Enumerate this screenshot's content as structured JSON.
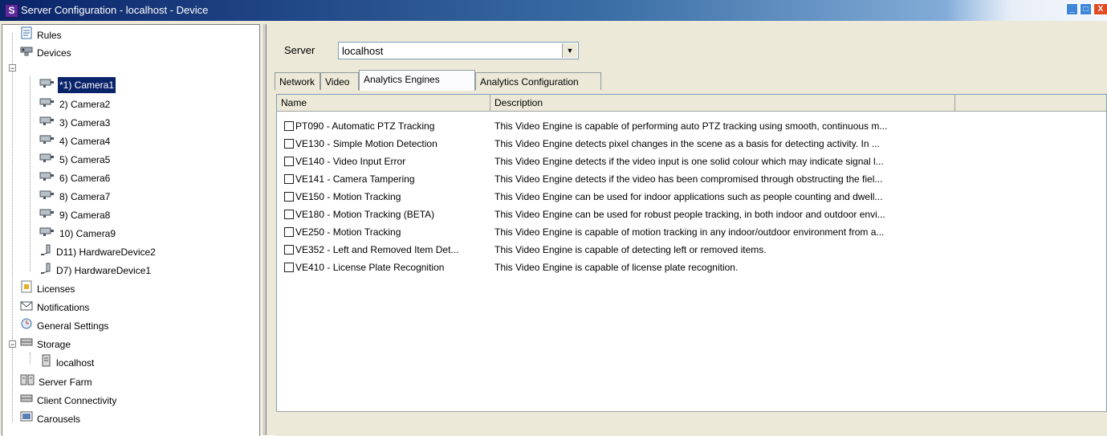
{
  "window": {
    "title": "Server Configuration - localhost - Device",
    "app_icon": "S",
    "controls": {
      "minimize": "_",
      "maximize": "□",
      "close": "X"
    }
  },
  "tree": {
    "items": [
      {
        "label": "Rules",
        "icon": "rules-icon"
      },
      {
        "label": "Devices",
        "icon": "devices-icon"
      },
      {
        "label": "*1) Camera1",
        "icon": "camera-icon"
      },
      {
        "label": "2) Camera2",
        "icon": "camera-icon"
      },
      {
        "label": "3) Camera3",
        "icon": "camera-icon"
      },
      {
        "label": "4) Camera4",
        "icon": "camera-icon"
      },
      {
        "label": "5) Camera5",
        "icon": "camera-icon"
      },
      {
        "label": "6) Camera6",
        "icon": "camera-icon"
      },
      {
        "label": "8) Camera7",
        "icon": "camera-icon"
      },
      {
        "label": "9) Camera8",
        "icon": "camera-icon"
      },
      {
        "label": "10) Camera9",
        "icon": "camera-icon"
      },
      {
        "label": "D11) HardwareDevice2",
        "icon": "hardware-device-icon"
      },
      {
        "label": "D7) HardwareDevice1",
        "icon": "hardware-device-icon"
      },
      {
        "label": "Licenses",
        "icon": "licenses-icon"
      },
      {
        "label": "Notifications",
        "icon": "notifications-icon"
      },
      {
        "label": "General Settings",
        "icon": "general-settings-icon"
      },
      {
        "label": "Storage",
        "icon": "storage-icon"
      },
      {
        "label": "localhost",
        "icon": "storage-server-icon"
      },
      {
        "label": "Server Farm",
        "icon": "server-farm-icon"
      },
      {
        "label": "Client Connectivity",
        "icon": "client-connectivity-icon"
      },
      {
        "label": "Carousels",
        "icon": "carousels-icon"
      }
    ],
    "selected": "*1) Camera1"
  },
  "server": {
    "label": "Server",
    "value": "localhost"
  },
  "tabs": [
    {
      "label": "Network"
    },
    {
      "label": "Video"
    },
    {
      "label": "Analytics Engines"
    },
    {
      "label": "Analytics Configuration"
    }
  ],
  "active_tab": "Analytics Engines",
  "table": {
    "columns": [
      "Name",
      "Description"
    ],
    "rows": [
      {
        "name": "PT090 - Automatic PTZ Tracking",
        "description": "This Video Engine is capable of performing auto PTZ tracking using smooth, continuous m..."
      },
      {
        "name": "VE130 - Simple Motion Detection",
        "description": "This Video Engine detects pixel changes in the scene as a basis for detecting activity. In ..."
      },
      {
        "name": "VE140 - Video Input Error",
        "description": "This Video Engine detects if the video input is one solid colour which may indicate signal l..."
      },
      {
        "name": "VE141 - Camera Tampering",
        "description": "This Video Engine detects if the video has been compromised through obstructing the fiel..."
      },
      {
        "name": "VE150 - Motion Tracking",
        "description": "This Video Engine can be used for indoor applications such as people counting and dwell..."
      },
      {
        "name": "VE180 - Motion Tracking (BETA)",
        "description": "This Video Engine can be used for robust people tracking, in both indoor and outdoor envi..."
      },
      {
        "name": "VE250 - Motion Tracking",
        "description": "This Video Engine is capable of motion tracking in any indoor/outdoor environment from a..."
      },
      {
        "name": "VE352 - Left and Removed Item Det...",
        "description": "This Video Engine is capable of detecting left or removed items."
      },
      {
        "name": "VE410 - License Plate Recognition",
        "description": "This Video Engine is capable of license plate recognition."
      }
    ]
  },
  "colors": {
    "selection": "#0a246a",
    "window_bg": "#ece9d8",
    "title_start": "#0a246a",
    "close_button": "#e24a24"
  }
}
